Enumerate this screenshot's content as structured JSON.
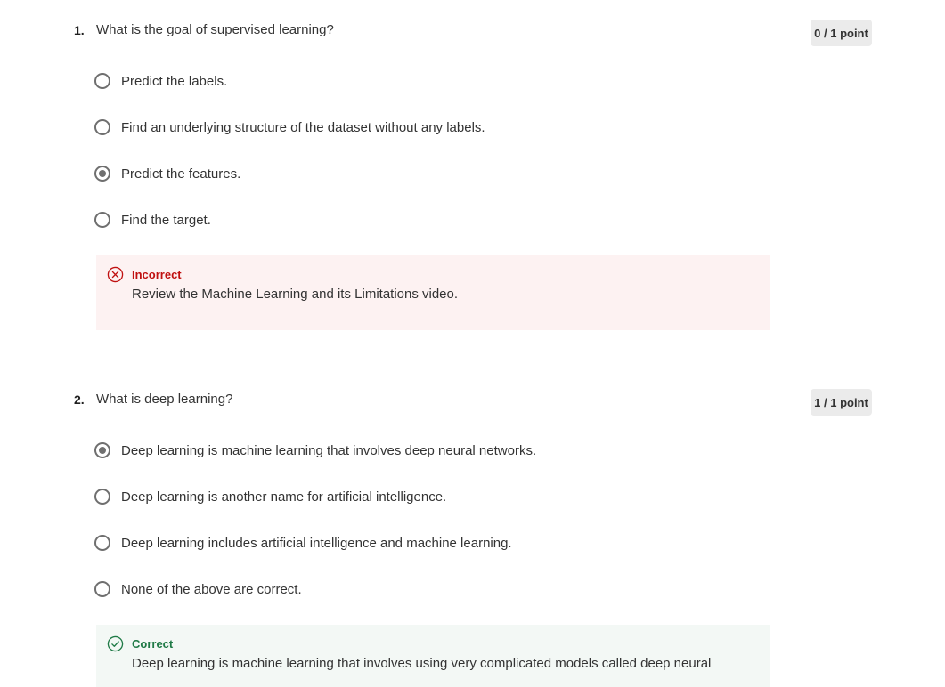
{
  "questions": [
    {
      "number": "1.",
      "text": "What is the goal of supervised learning?",
      "score": "0 / 1 point",
      "options": [
        {
          "label": "Predict the labels.",
          "selected": false
        },
        {
          "label": "Find an underlying structure of the dataset without any labels.",
          "selected": false
        },
        {
          "label": "Predict the features.",
          "selected": true
        },
        {
          "label": "Find the target.",
          "selected": false
        }
      ],
      "feedback": {
        "status": "Incorrect",
        "message": "Review the Machine Learning and its Limitations video.",
        "icon": "x-circle-icon",
        "color": "#c01010",
        "background": "#fdf2f2"
      }
    },
    {
      "number": "2.",
      "text": "What is deep learning?",
      "score": "1 / 1 point",
      "options": [
        {
          "label": "Deep learning is machine learning that involves deep neural networks.",
          "selected": true
        },
        {
          "label": "Deep learning is another name for artificial intelligence.",
          "selected": false
        },
        {
          "label": "Deep learning includes artificial intelligence and machine learning.",
          "selected": false
        },
        {
          "label": "None of the above are correct.",
          "selected": false
        }
      ],
      "feedback": {
        "status": "Correct",
        "message": "Deep learning is machine learning that involves using very complicated models called deep neural",
        "icon": "check-circle-icon",
        "color": "#1f7a46",
        "background": "#f3f8f5"
      }
    }
  ]
}
